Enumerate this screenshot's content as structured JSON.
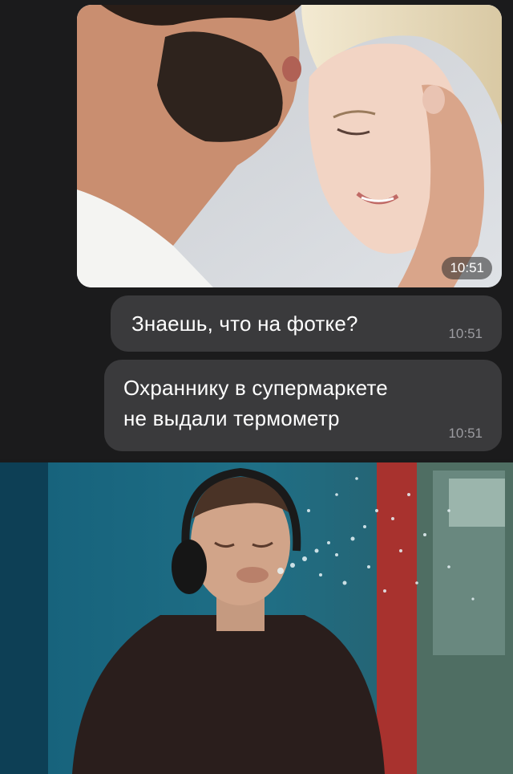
{
  "chat": {
    "photo_message": {
      "time": "10:51"
    },
    "messages": [
      {
        "lines": [
          "Знаешь, что на фотке?"
        ],
        "time": "10:51"
      },
      {
        "lines": [
          "Охраннику в супермаркете",
          "не выдали термометр"
        ],
        "time": "10:51"
      }
    ]
  },
  "colors": {
    "background": "#1b1b1c",
    "bubble": "#3a3a3c",
    "text": "#ffffff",
    "time_text": "#9c9ca1"
  }
}
